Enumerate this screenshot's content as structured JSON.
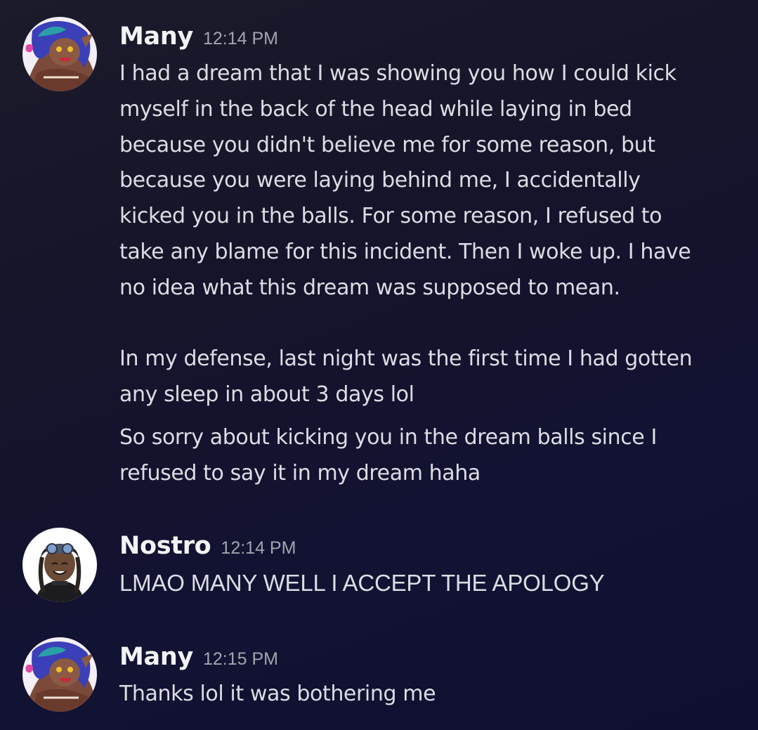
{
  "messages": [
    {
      "author": "Many",
      "timestamp": "12:14 PM",
      "avatar_icon": "user-avatar-many",
      "paragraphs": [
        {
          "lines": [
            "I had a dream that I was showing you how I could kick",
            "myself in the back of the head while laying in bed",
            "because you didn't believe me for some reason, but",
            "because you were laying behind me, I accidentally",
            "kicked you in the balls. For some reason, I refused to",
            "take any blame for this incident. Then I woke up. I have",
            "no idea what this dream was supposed to mean."
          ]
        },
        {
          "lines": [
            "In my defense, last night was the first time I had gotten",
            "any sleep in about 3 days lol"
          ]
        },
        {
          "lines": [
            "So sorry about kicking you in the dream balls since I",
            "refused to say it in my dream haha"
          ]
        }
      ]
    },
    {
      "author": "Nostro",
      "timestamp": "12:14 PM",
      "avatar_icon": "user-avatar-nostro",
      "paragraphs": [
        {
          "lines": [
            "LMAO MANY WELL I ACCEPT THE APOLOGY"
          ]
        }
      ]
    },
    {
      "author": "Many",
      "timestamp": "12:15 PM",
      "avatar_icon": "user-avatar-many",
      "paragraphs": [
        {
          "lines": [
            "Thanks lol it was bothering me"
          ]
        }
      ]
    }
  ],
  "colors": {
    "background": "#15142a",
    "username": "#f2f3f5",
    "timestamp": "#a2a4ae",
    "message_text": "#dcdde4"
  }
}
